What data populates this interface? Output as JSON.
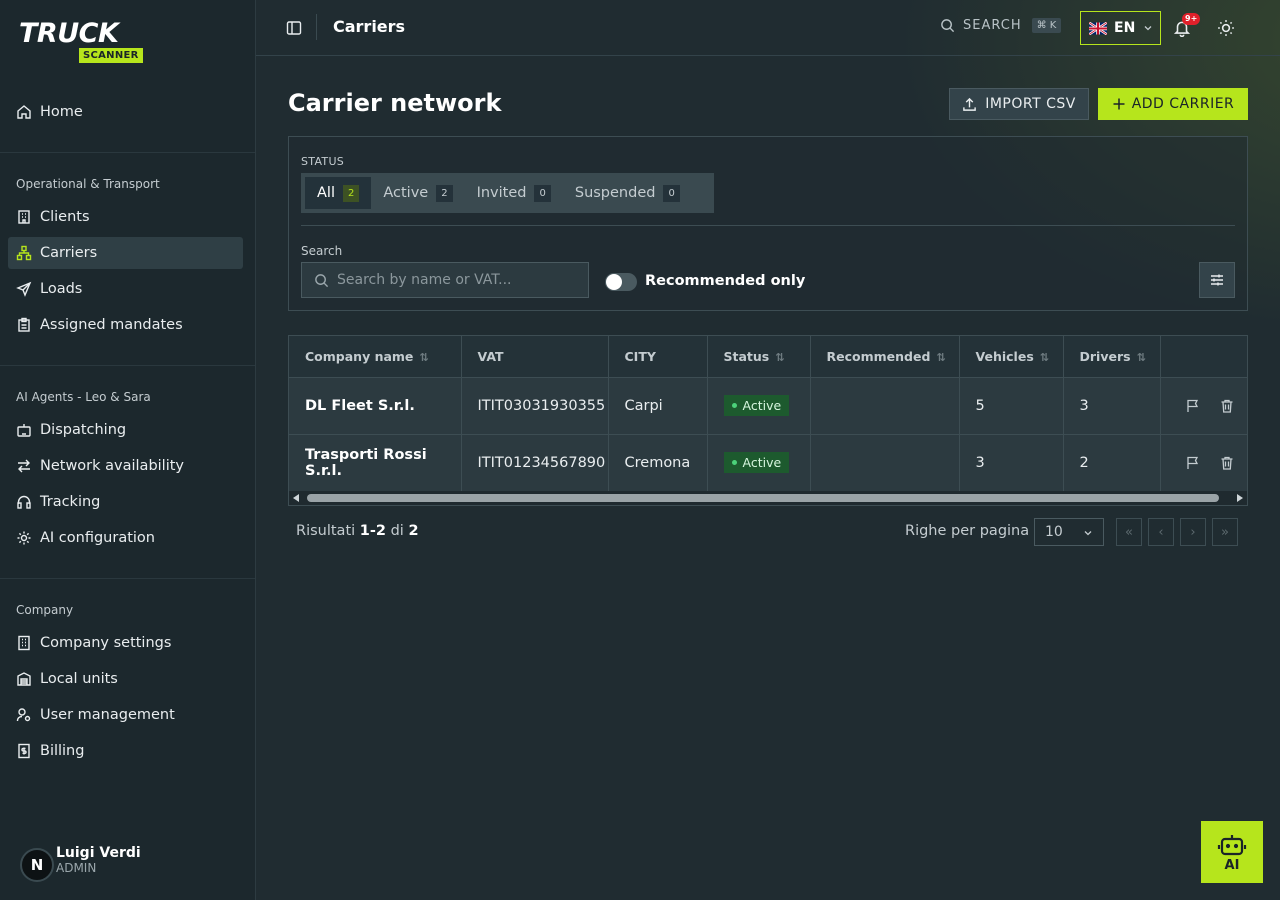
{
  "brand": {
    "logo_top": "TRUCK",
    "logo_bottom": "SCANNER",
    "accent": "#b6e51c"
  },
  "sidebar": {
    "home": "Home",
    "sections": [
      {
        "title": "Operational & Transport",
        "items": [
          "Clients",
          "Carriers",
          "Loads",
          "Assigned mandates"
        ]
      },
      {
        "title": "AI Agents - Leo & Sara",
        "items": [
          "Dispatching",
          "Network availability",
          "Tracking",
          "AI configuration"
        ]
      },
      {
        "title": "Company",
        "items": [
          "Company settings",
          "Local units",
          "User management",
          "Billing"
        ]
      }
    ],
    "active_item": "Carriers"
  },
  "user": {
    "initial": "N",
    "name": "Luigi Verdi",
    "role": "ADMIN"
  },
  "topbar": {
    "title": "Carriers",
    "search_label": "SEARCH",
    "search_shortcut": "⌘ K",
    "language": "EN",
    "notifications_badge": "9+"
  },
  "page": {
    "title": "Carrier network",
    "import_label": "IMPORT CSV",
    "add_label": "ADD CARRIER"
  },
  "filters": {
    "status_label": "STATUS",
    "tabs": [
      {
        "label": "All",
        "count": "2"
      },
      {
        "label": "Active",
        "count": "2"
      },
      {
        "label": "Invited",
        "count": "0"
      },
      {
        "label": "Suspended",
        "count": "0"
      }
    ],
    "active_tab": "All",
    "search_label": "Search",
    "search_placeholder": "Search by name or VAT...",
    "recommended_label": "Recommended only",
    "recommended_on": false
  },
  "table": {
    "columns": [
      "Company name",
      "VAT",
      "CITY",
      "Status",
      "Recommended",
      "Vehicles",
      "Drivers"
    ],
    "sortable": [
      true,
      false,
      false,
      true,
      true,
      true,
      true
    ],
    "rows": [
      {
        "company": "DL Fleet S.r.l.",
        "vat": "ITIT03031930355",
        "city": "Carpi",
        "status": "Active",
        "recommended": "",
        "vehicles": "5",
        "drivers": "3"
      },
      {
        "company": "Trasporti Rossi S.r.l.",
        "vat": "ITIT01234567890",
        "city": "Cremona",
        "status": "Active",
        "recommended": "",
        "vehicles": "3",
        "drivers": "2"
      }
    ]
  },
  "pagination": {
    "results_prefix": "Risultati",
    "range": "1-2",
    "of": "di",
    "total": "2",
    "rows_per_page_label": "Righe per pagina",
    "rows_per_page": "10"
  },
  "ai_button": {
    "label": "AI"
  }
}
